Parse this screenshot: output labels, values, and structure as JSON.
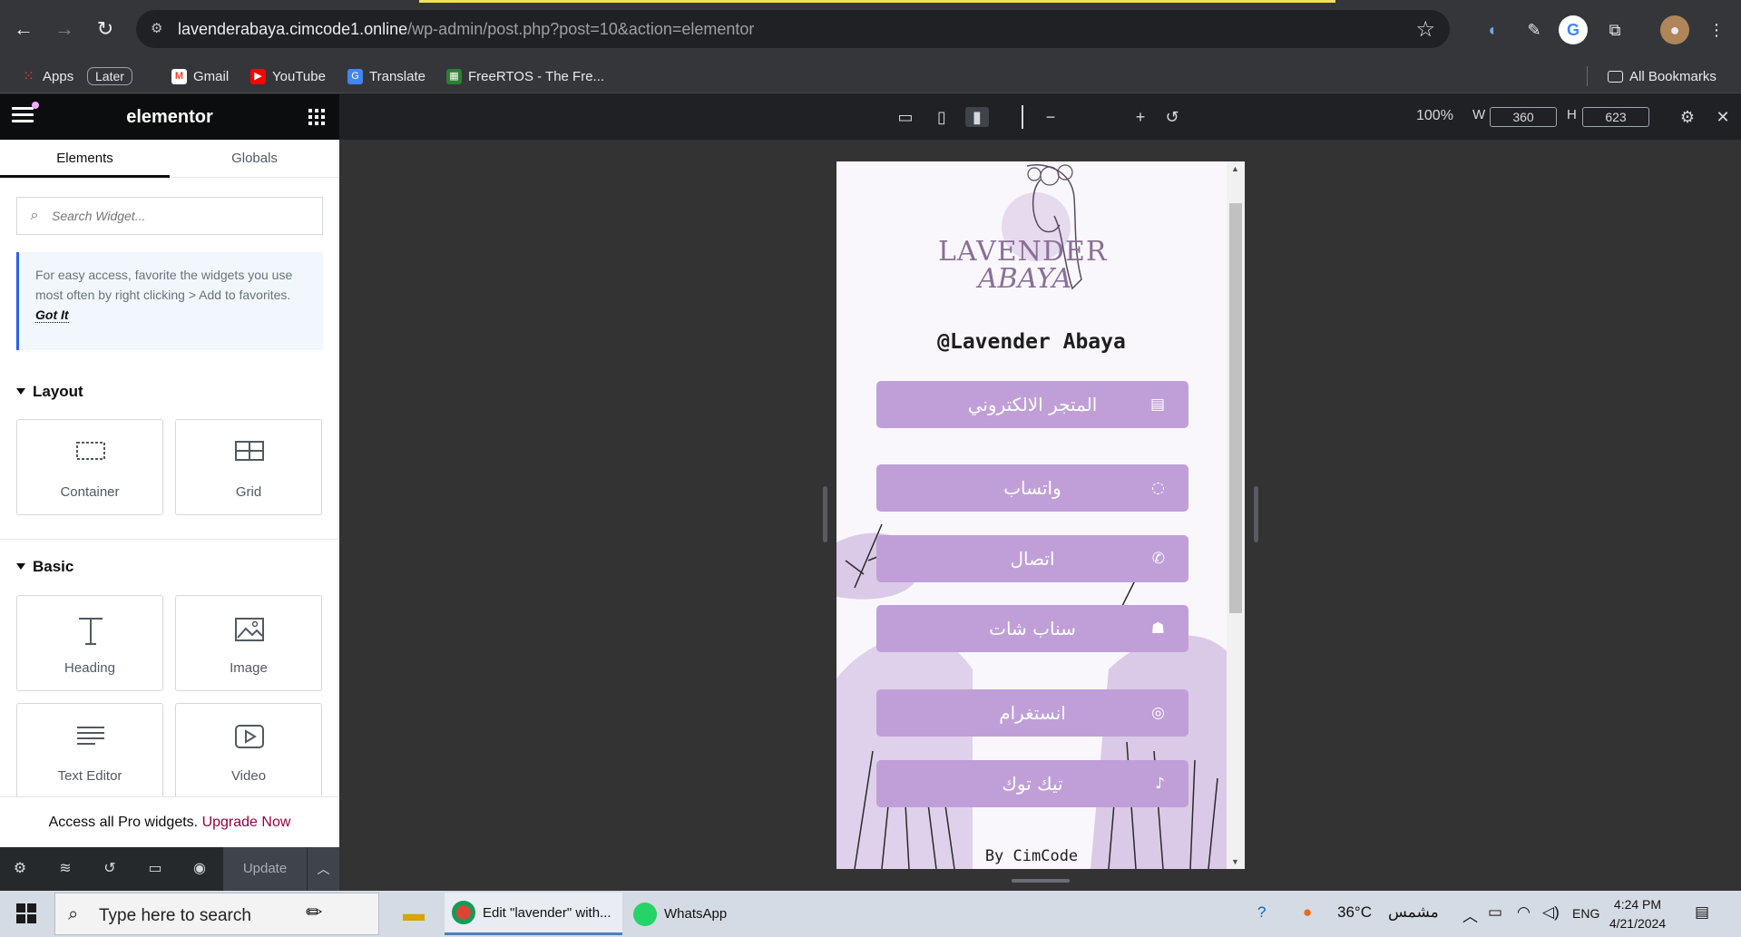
{
  "browser": {
    "url_host": "lavenderabaya.cimcode1.online",
    "url_path": "/wp-admin/post.php?post=10&action=elementor",
    "bookmarks": [
      "Apps",
      "Later",
      "Gmail",
      "YouTube",
      "Translate",
      "FreeRTOS - The Fre..."
    ],
    "all_bookmarks": "All Bookmarks"
  },
  "editor": {
    "logo": "elementor",
    "tabs": [
      "Elements",
      "Globals"
    ],
    "search_placeholder": "Search Widget...",
    "tip_text": "For easy access, favorite the widgets you use most often by right clicking > Add to favorites.",
    "tip_link": "Got It",
    "categories": {
      "layout": "Layout",
      "basic": "Basic"
    },
    "widgets": {
      "container": "Container",
      "grid": "Grid",
      "heading": "Heading",
      "image": "Image",
      "text_editor": "Text Editor",
      "video": "Video"
    },
    "pro_text": "Access all Pro widgets.",
    "pro_link": "Upgrade Now",
    "update": "Update"
  },
  "canvas": {
    "zoom": "100%",
    "w_label": "W",
    "w_value": "360",
    "h_label": "H",
    "h_value": "623"
  },
  "preview": {
    "brand_line1": "LAVENDER",
    "brand_line2": "ABAYA",
    "handle": "@Lavender Abaya",
    "buttons": [
      {
        "label": "المتجر الالكتروني",
        "icon": "store-icon"
      },
      {
        "label": "واتساب",
        "icon": "whatsapp-icon"
      },
      {
        "label": "اتصال",
        "icon": "phone-icon"
      },
      {
        "label": "سناب شات",
        "icon": "snapchat-icon"
      },
      {
        "label": "انستغرام",
        "icon": "instagram-icon"
      },
      {
        "label": "تيك توك",
        "icon": "tiktok-icon"
      }
    ],
    "byline": "By CimCode",
    "accent": "#c09fd8"
  },
  "taskbar": {
    "search_placeholder": "Type here to search",
    "app1": "Edit \"lavender\" with...",
    "app2": "WhatsApp",
    "weather": "36°C",
    "weather_text": "مشمس",
    "lang": "ENG",
    "time": "4:24 PM",
    "date": "4/21/2024"
  }
}
